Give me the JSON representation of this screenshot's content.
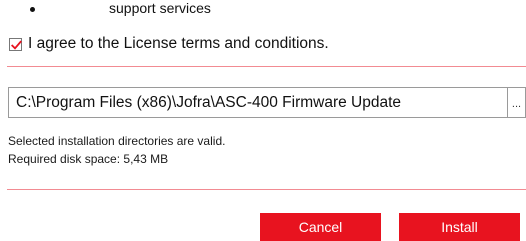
{
  "feature_list": {
    "bullet_item": "support services"
  },
  "license": {
    "checkbox_checked": true,
    "agree_label": "I agree to the License terms and conditions."
  },
  "install_path": {
    "value": "C:\\Program Files (x86)\\Jofra\\ASC-400 Firmware Update",
    "browse_label": "..."
  },
  "status": {
    "valid_message": "Selected installation directories are valid.",
    "disk_space": "Required disk space: 5,43 MB"
  },
  "buttons": {
    "cancel_label": "Cancel",
    "install_label": "Install"
  },
  "colors": {
    "accent": "#e8131f",
    "divider": "#f28b92"
  }
}
